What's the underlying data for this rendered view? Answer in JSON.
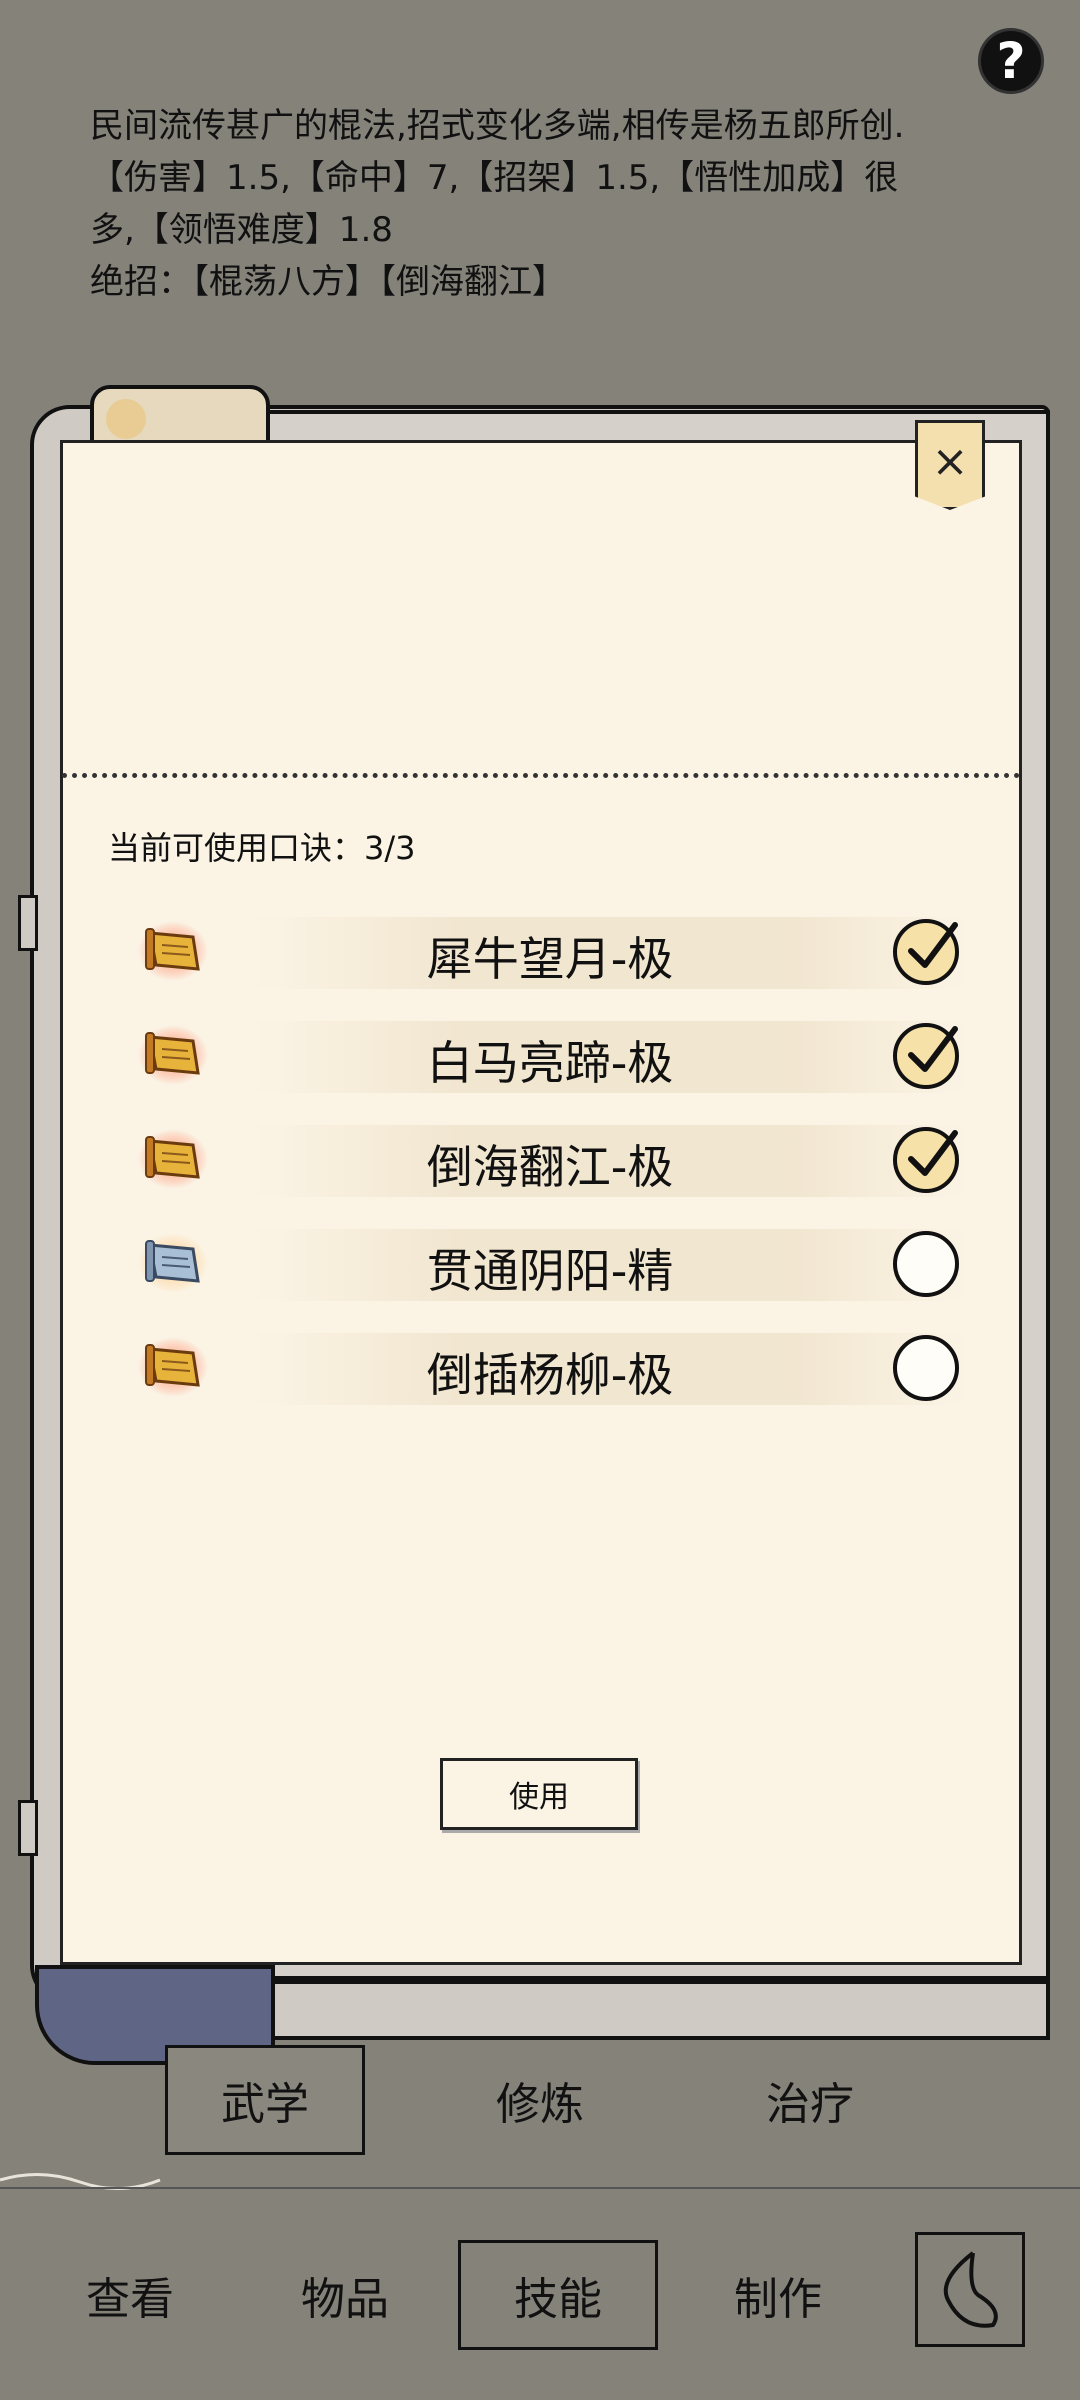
{
  "help": {
    "icon": "question-mark-icon",
    "label": "?"
  },
  "description": {
    "line1": "民间流传甚广的棍法,招式变化多端,相传是杨五郎所创.",
    "line2": "【伤害】1.5,【命中】7,【招架】1.5,【悟性加成】很",
    "line3": "多,【领悟难度】1.8",
    "line4": "绝招：【棍荡八方】【倒海翻江】"
  },
  "dialog": {
    "close_icon": "close-icon",
    "close_label": "×",
    "slot_count": "当前可使用口诀：3/3",
    "use_label": "使用",
    "skills": [
      {
        "name": "犀牛望月-极",
        "icon": "gold-scroll-icon",
        "checked": true
      },
      {
        "name": "白马亮蹄-极",
        "icon": "gold-scroll-icon",
        "checked": true
      },
      {
        "name": "倒海翻江-极",
        "icon": "gold-scroll-icon",
        "checked": true
      },
      {
        "name": "贯通阴阳-精",
        "icon": "blue-scroll-icon",
        "checked": false
      },
      {
        "name": "倒插杨柳-极",
        "icon": "gold-scroll-icon",
        "checked": false
      }
    ]
  },
  "subtabs": [
    {
      "label": "武学",
      "active": true
    },
    {
      "label": "修炼",
      "active": false
    },
    {
      "label": "治疗",
      "active": false
    }
  ],
  "bottom_nav": [
    {
      "label": "查看",
      "active": false
    },
    {
      "label": "物品",
      "active": false
    },
    {
      "label": "技能",
      "active": true
    },
    {
      "label": "制作",
      "active": false
    }
  ],
  "back_icon": "back-arrow-icon",
  "colors": {
    "background": "#85827a",
    "paper": "#fbf4e5",
    "gold_scroll": "#e8b33a",
    "blue_scroll": "#a9bfd6",
    "scroll_roll": "#5f6685"
  }
}
